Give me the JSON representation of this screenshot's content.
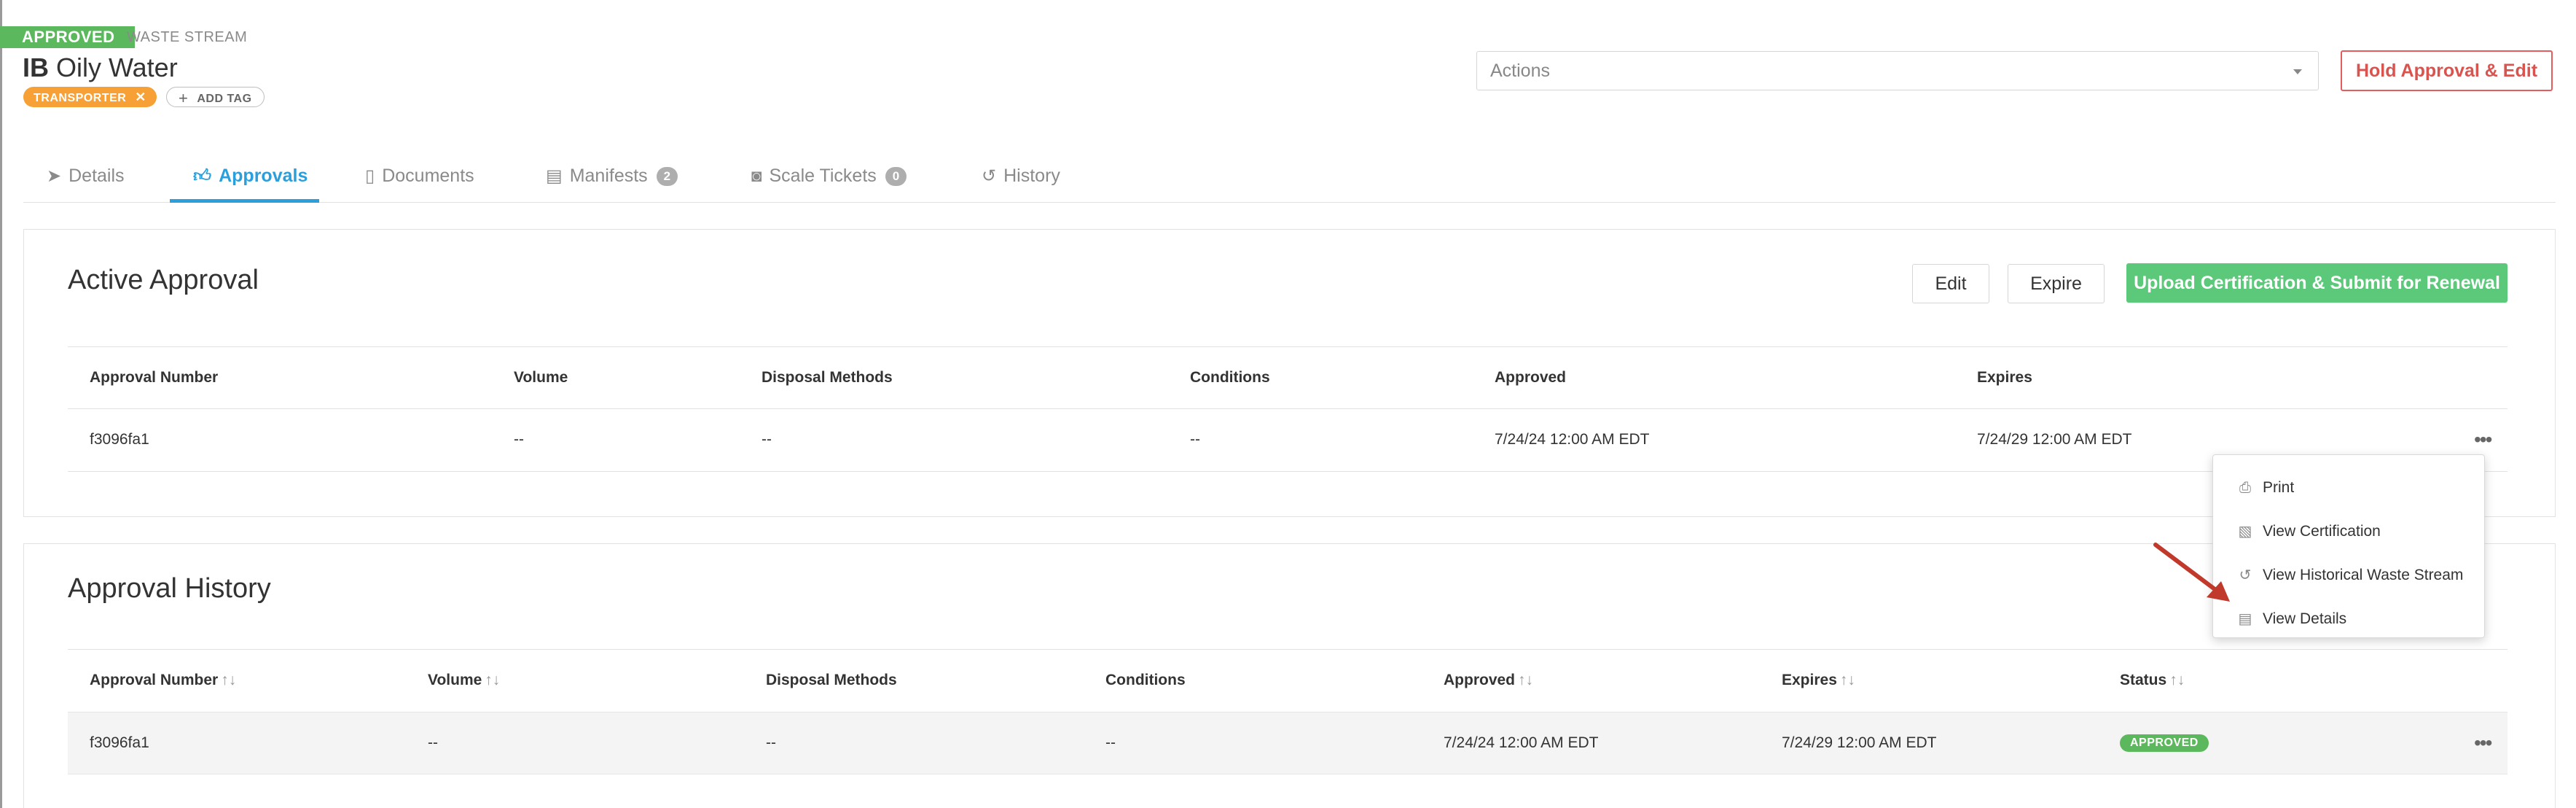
{
  "header": {
    "status": "APPROVED",
    "category": "WASTE STREAM",
    "title_prefix": "IB",
    "title": "Oily Water",
    "tags": [
      {
        "label": "TRANSPORTER"
      }
    ],
    "add_tag_label": "ADD TAG",
    "actions_placeholder": "Actions",
    "hold_button": "Hold Approval & Edit"
  },
  "tabs": [
    {
      "label": "Details",
      "icon": "paper-plane-icon"
    },
    {
      "label": "Approvals",
      "icon": "thumbs-up-icon",
      "active": true
    },
    {
      "label": "Documents",
      "icon": "document-icon"
    },
    {
      "label": "Manifests",
      "icon": "clipboard-icon",
      "count": "2"
    },
    {
      "label": "Scale Tickets",
      "icon": "camera-icon",
      "count": "0"
    },
    {
      "label": "History",
      "icon": "history-icon"
    }
  ],
  "active_approval": {
    "title": "Active Approval",
    "edit_button": "Edit",
    "expire_button": "Expire",
    "upload_button": "Upload Certification & Submit for Renewal",
    "columns": [
      "Approval Number",
      "Volume",
      "Disposal Methods",
      "Conditions",
      "Approved",
      "Expires"
    ],
    "rows": [
      {
        "approval_number": "f3096fa1",
        "volume": "--",
        "disposal_methods": "--",
        "conditions": "--",
        "approved": "7/24/24 12:00 AM EDT",
        "expires": "7/24/29 12:00 AM EDT"
      }
    ],
    "row_menu": [
      {
        "label": "Print",
        "icon": "printer-icon"
      },
      {
        "label": "View Certification",
        "icon": "certificate-icon"
      },
      {
        "label": "View Historical Waste Stream",
        "icon": "history-icon"
      },
      {
        "label": "View Details",
        "icon": "document-icon"
      }
    ]
  },
  "approval_history": {
    "title": "Approval History",
    "columns": [
      "Approval Number",
      "Volume",
      "Disposal Methods",
      "Conditions",
      "Approved",
      "Expires",
      "Status"
    ],
    "rows": [
      {
        "approval_number": "f3096fa1",
        "volume": "--",
        "disposal_methods": "--",
        "conditions": "--",
        "approved": "7/24/24 12:00 AM EDT",
        "expires": "7/24/29 12:00 AM EDT",
        "status": "APPROVED"
      }
    ]
  },
  "colors": {
    "approved_green": "#5cb85c",
    "accent_blue": "#2b9fdc",
    "tag_orange": "#f7a035",
    "danger_red": "#d9534f",
    "upload_green": "#5cc87a",
    "annotation_arrow": "#c0392b"
  }
}
